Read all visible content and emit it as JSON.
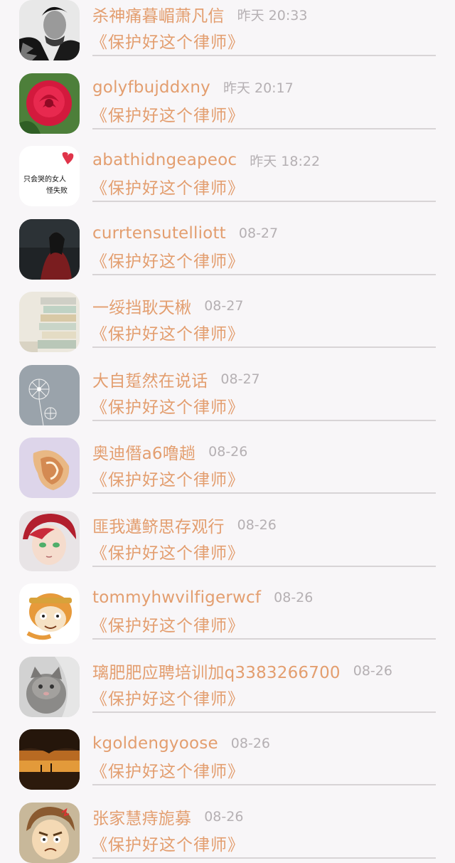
{
  "messages": [
    {
      "sender": "杀神痛暮嵋萧凡信",
      "time": "昨天 20:33",
      "title": "《保护好这个律师》",
      "avatar": "man-portrait-avatar"
    },
    {
      "sender": "golyfbujddxny",
      "time": "昨天 20:17",
      "title": "《保护好这个律师》",
      "avatar": "red-rose-avatar"
    },
    {
      "sender": "abathidngeapeoc",
      "time": "昨天 18:22",
      "title": "《保护好这个律师》",
      "avatar": "handwritten-text-avatar",
      "avatar_text": [
        "只会哭的女人",
        "怪失败"
      ]
    },
    {
      "sender": "currtensutelliott",
      "time": "08-27",
      "title": "《保护好这个律师》",
      "avatar": "dark-figure-avatar"
    },
    {
      "sender": "一绥挡耿天楸",
      "time": "08-27",
      "title": "《保护好这个律师》",
      "avatar": "books-avatar"
    },
    {
      "sender": "大自踅然在说话",
      "time": "08-27",
      "title": "《保护好这个律师》",
      "avatar": "dandelion-avatar"
    },
    {
      "sender": "奥迪僭a6噜趟",
      "time": "08-26",
      "title": "《保护好这个律师》",
      "avatar": "seashell-avatar"
    },
    {
      "sender": "匪我遘鲚思存观行",
      "time": "08-26",
      "title": "《保护好这个律师》",
      "avatar": "anime-boy-avatar"
    },
    {
      "sender": "tommyhwvilfigerwcf",
      "time": "08-26",
      "title": "《保护好这个律师》",
      "avatar": "cartoon-monkey-avatar"
    },
    {
      "sender": "璃肥肥应聘培训加q3383266700",
      "time": "08-26",
      "title": "《保护好这个律师》",
      "avatar": "cat-avatar"
    },
    {
      "sender": "kgoldengyoose",
      "time": "08-26",
      "title": "《保护好这个律师》",
      "avatar": "sunset-park-avatar"
    },
    {
      "sender": "张家慧痔旎募",
      "time": "08-26",
      "title": "《保护好这个律师》",
      "avatar": "angry-cartoon-avatar"
    }
  ],
  "colors": {
    "accent": "#e39e6f",
    "time": "#b5b0b3",
    "divider": "#d8d4d6",
    "background": "#f8f6f8"
  }
}
